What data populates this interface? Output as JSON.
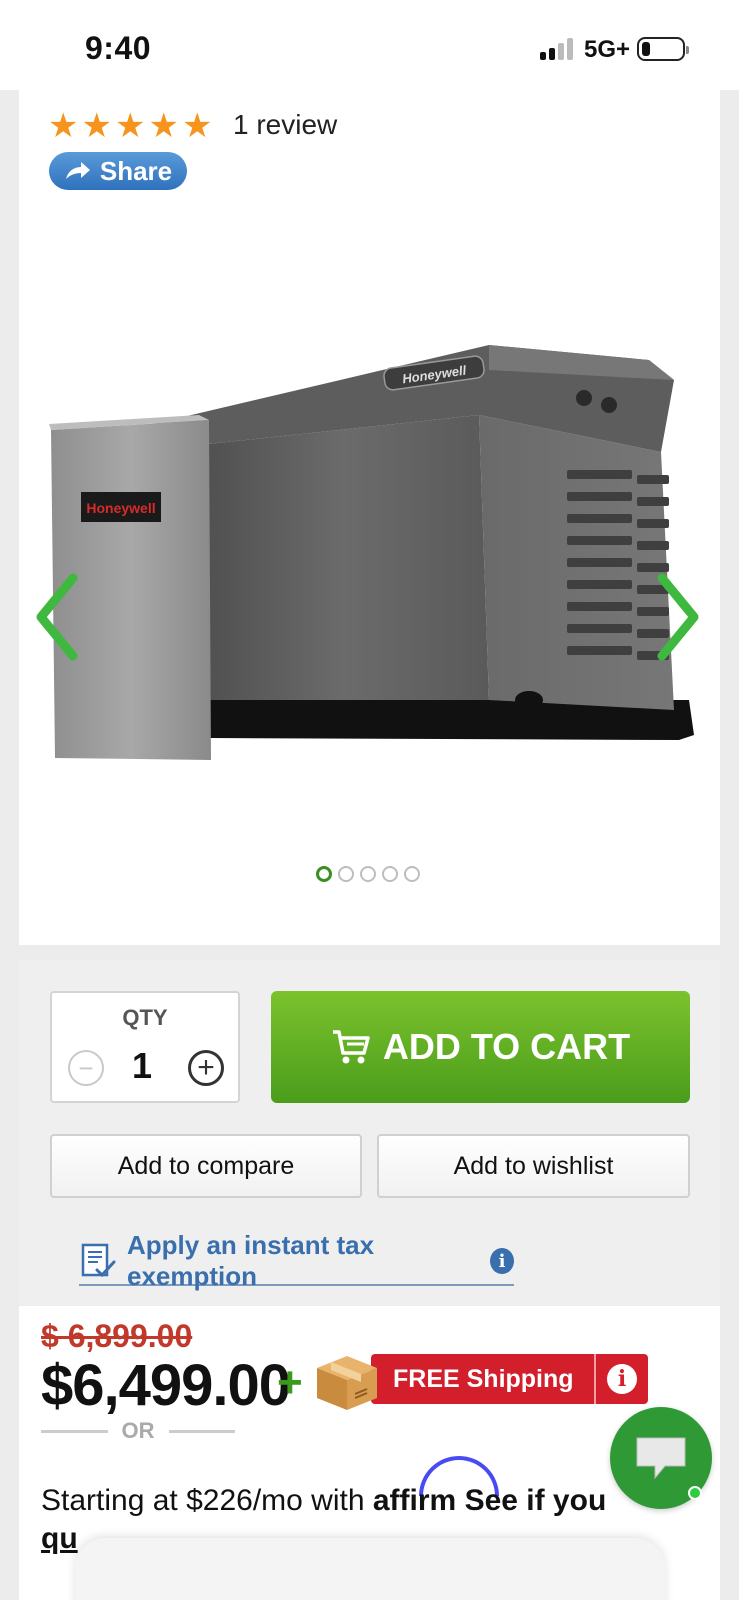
{
  "status_bar": {
    "time": "9:40",
    "network": "5G+"
  },
  "product": {
    "rating": 5,
    "review_count_label": "1 review",
    "share_label": "Share",
    "image_brand": "Honeywell",
    "gallery_total": 5,
    "gallery_active": 1
  },
  "purchase": {
    "qty_label": "QTY",
    "qty_value": "1",
    "add_to_cart_label": "ADD TO CART",
    "compare_label": "Add to compare",
    "wishlist_label": "Add to wishlist",
    "tax_exemption_label": "Apply an instant tax exemption"
  },
  "price": {
    "old_price": "$ 6,899.00",
    "new_price": "$6,499.00",
    "free_shipping_label": "FREE Shipping",
    "or_label": "OR",
    "affirm_prefix": "Starting at $226/mo with",
    "affirm_brand": "affirm",
    "affirm_cta": "See if you",
    "affirm_cta_cont": "qu"
  },
  "colors": {
    "accent_green": "#4a9d1b",
    "star_orange": "#f7941d",
    "link_blue": "#3a6fae",
    "sale_red": "#c0392b",
    "shipping_red": "#d21f2b"
  },
  "icons": [
    "star-icon",
    "share-arrow-icon",
    "chevron-left-icon",
    "chevron-right-icon",
    "cart-icon",
    "minus-icon",
    "plus-icon",
    "document-check-icon",
    "info-icon",
    "box-icon",
    "chat-icon"
  ]
}
